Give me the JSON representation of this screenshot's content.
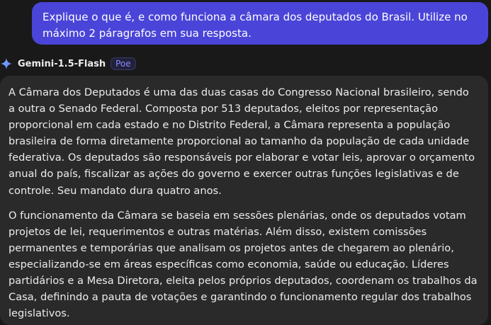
{
  "user_message": {
    "text": "Explique o que é, e como funciona a câmara dos deputados do Brasil. Utilize no máximo 2 páragrafos em sua resposta."
  },
  "bot": {
    "name": "Gemini-1.5-Flash",
    "badge": "Poe",
    "avatar_icon": "sparkle-icon",
    "paragraphs": [
      "A Câmara dos Deputados é uma das duas casas do Congresso Nacional brasileiro, sendo a outra o Senado Federal. Composta por 513 deputados, eleitos por representação proporcional em cada estado e no Distrito Federal, a Câmara representa a população brasileira de forma diretamente proporcional ao tamanho da população de cada unidade federativa. Os deputados são responsáveis por elaborar e votar leis, aprovar o orçamento anual do país, fiscalizar as ações do governo e exercer outras funções legislativas e de controle. Seu mandato dura quatro anos.",
      "O funcionamento da Câmara se baseia em sessões plenárias, onde os deputados votam projetos de lei, requerimentos e outras matérias. Além disso, existem comissões permanentes e temporárias que analisam os projetos antes de chegarem ao plenário, especializando-se em áreas específicas como economia, saúde ou educação. Líderes partidários e a Mesa Diretora, eleita pelos próprios deputados, coordenam os trabalhos da Casa, definindo a pauta de votações e garantindo o funcionamento regular dos trabalhos legislativos."
    ]
  },
  "colors": {
    "background": "#191919",
    "user_bubble": "#4a45d8",
    "bot_bubble": "#2a2a2a",
    "text": "#ececec",
    "badge_text": "#8a8aff"
  }
}
